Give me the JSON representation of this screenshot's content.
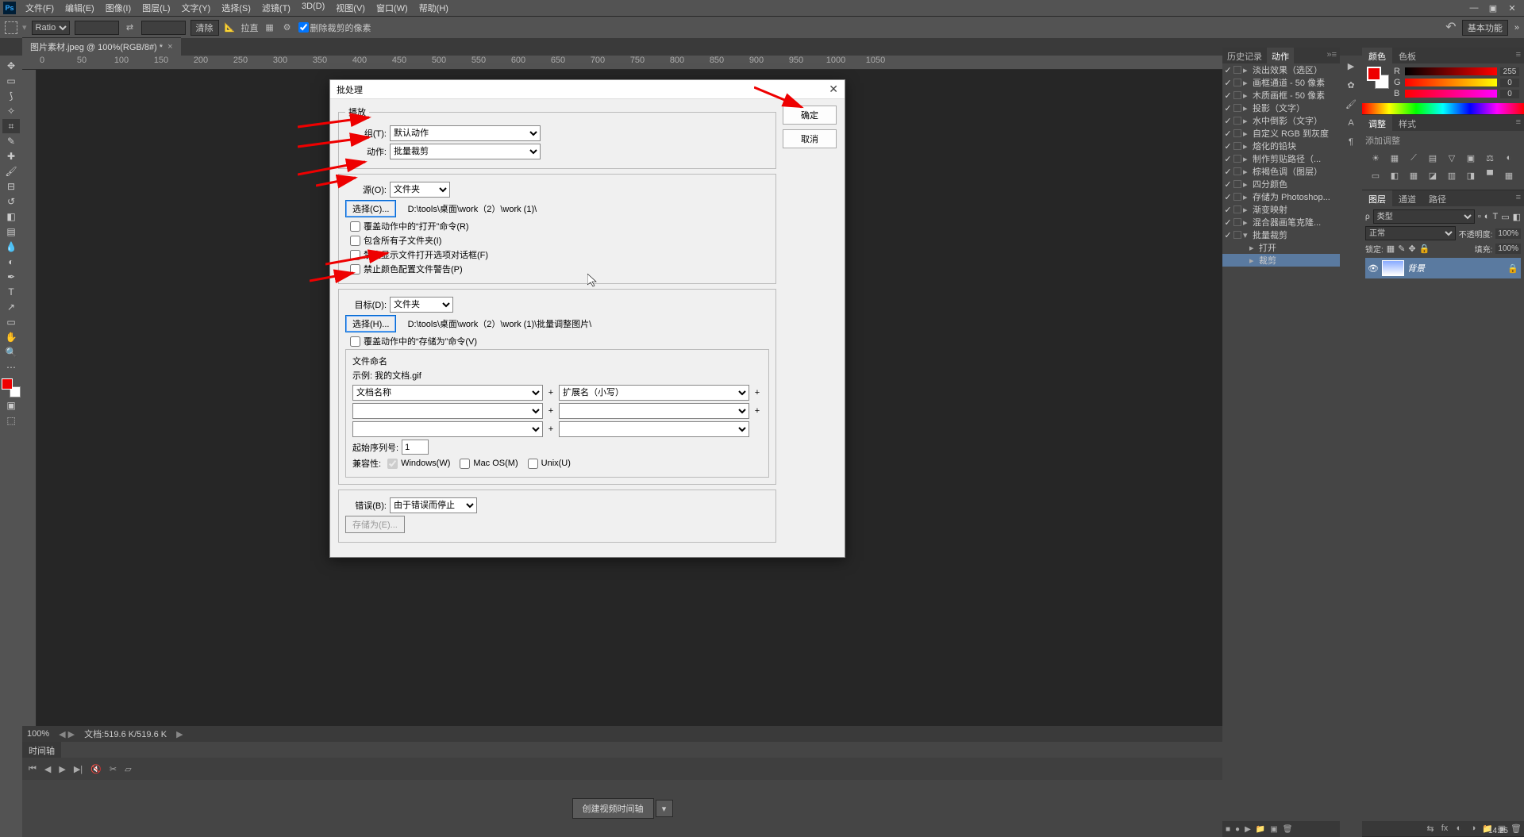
{
  "menu": [
    "文件(F)",
    "编辑(E)",
    "图像(I)",
    "图层(L)",
    "文字(Y)",
    "选择(S)",
    "滤镜(T)",
    "3D(D)",
    "视图(V)",
    "窗口(W)",
    "帮助(H)"
  ],
  "opt": {
    "ratio": "Ratio",
    "clear": "清除",
    "straighten": "拉直",
    "deleteCropped": "删除裁剪的像素",
    "workspace": "基本功能"
  },
  "docTab": "图片素材.jpeg @ 100%(RGB/8#) *",
  "rulerMarks": [
    "0",
    "50",
    "100",
    "150",
    "200",
    "250",
    "300",
    "350",
    "400",
    "450",
    "500",
    "550",
    "600",
    "650",
    "700",
    "750",
    "800",
    "850",
    "900",
    "950",
    "1000",
    "1050"
  ],
  "dialog": {
    "title": "批处理",
    "ok": "确定",
    "cancel": "取消",
    "play": {
      "legend": "播放",
      "group": "组(T):",
      "groupVal": "默认动作",
      "action": "动作:",
      "actionVal": "批量裁剪"
    },
    "source": {
      "label": "源(O):",
      "val": "文件夹",
      "choose": "选择(C)...",
      "path": "D:\\tools\\桌面\\work（2）\\work (1)\\",
      "c1": "覆盖动作中的“打开”命令(R)",
      "c2": "包含所有子文件夹(I)",
      "c3": "禁止显示文件打开选项对话框(F)",
      "c4": "禁止颜色配置文件警告(P)"
    },
    "dest": {
      "label": "目标(D):",
      "val": "文件夹",
      "choose": "选择(H)...",
      "path": "D:\\tools\\桌面\\work（2）\\work (1)\\批量调整图片\\",
      "override": "覆盖动作中的“存储为”命令(V)",
      "naming": "文件命名",
      "example": "示例: 我的文档.gif",
      "f1": "文档名称",
      "f2": "扩展名（小写）",
      "startLabel": "起始序列号:",
      "startVal": "1",
      "compat": "兼容性:",
      "win": "Windows(W)",
      "mac": "Mac OS(M)",
      "unix": "Unix(U)"
    },
    "errors": {
      "label": "错误(B):",
      "val": "由于错误而停止",
      "saveAs": "存储为(E)..."
    }
  },
  "panels": {
    "historyTab": "历史记录",
    "actionsTab": "动作",
    "actions": [
      "淡出效果（选区）",
      "画框通道 - 50 像素",
      "木质画框 - 50 像素",
      "投影（文字）",
      "水中倒影（文字）",
      "自定义 RGB 到灰度",
      "熔化的铅块",
      "制作剪贴路径（...",
      "棕褐色调（图层）",
      "四分颜色",
      "存储为 Photoshop...",
      "渐变映射",
      "混合器画笔克隆...",
      "批量裁剪"
    ],
    "sub": [
      "打开",
      "裁剪"
    ],
    "colorTab": "颜色",
    "swatchesTab": "色板",
    "rgb": {
      "r": "R",
      "g": "G",
      "b": "B",
      "rv": "255",
      "gv": "0",
      "bv": "0"
    },
    "adjustTab": "调整",
    "stylesTab": "样式",
    "addAdjust": "添加调整",
    "layersTab": "图层",
    "channelsTab": "通道",
    "pathsTab": "路径",
    "kind": "类型",
    "blend": "正常",
    "opacityL": "不透明度:",
    "opacityV": "100%",
    "lockL": "锁定:",
    "fillL": "填充:",
    "fillV": "100%",
    "layerName": "背景"
  },
  "status": {
    "zoom": "100%",
    "doc": "文档:519.6 K/519.6 K"
  },
  "timeline": {
    "tab": "时间轴",
    "btn": "创建视频时间轴"
  },
  "clock": "14:25"
}
